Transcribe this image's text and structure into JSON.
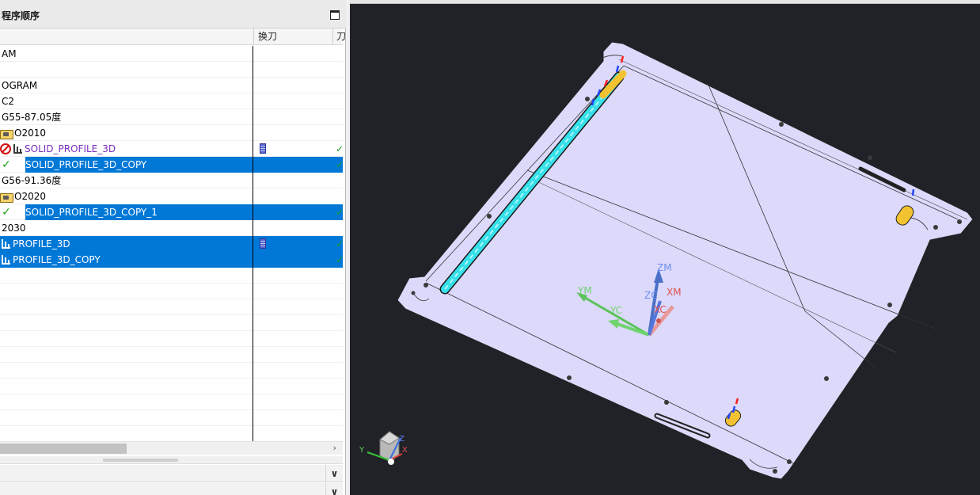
{
  "navigator": {
    "title": "程序顺序",
    "columns": {
      "change_tool": "换刀",
      "next": "刀"
    },
    "rows": [
      {
        "label": "AM",
        "indent": 0,
        "icon": "",
        "selected": false,
        "status": "",
        "tool": false,
        "check": false
      },
      {
        "label": "",
        "indent": 0,
        "icon": "",
        "selected": false,
        "status": "",
        "tool": false,
        "check": false
      },
      {
        "label": "OGRAM",
        "indent": 0,
        "icon": "",
        "selected": false,
        "status": "",
        "tool": false,
        "check": false
      },
      {
        "label": "C2",
        "indent": 0,
        "icon": "",
        "selected": false,
        "status": "",
        "tool": false,
        "check": false
      },
      {
        "label": "G55-87.05度",
        "indent": 0,
        "icon": "",
        "selected": false,
        "status": "",
        "tool": false,
        "check": false
      },
      {
        "label": "O2010",
        "indent": 0,
        "icon": "folder",
        "selected": false,
        "status": "",
        "tool": false,
        "check": false
      },
      {
        "label": "SOLID_PROFILE_3D",
        "indent": 0,
        "icon": "op",
        "selected": false,
        "status": "no",
        "tool": true,
        "check": true,
        "purple": true
      },
      {
        "label": "SOLID_PROFILE_3D_COPY",
        "indent": 0,
        "icon": "op",
        "selected": true,
        "status": "check",
        "tool": false,
        "check": true
      },
      {
        "label": "G56-91.36度",
        "indent": 0,
        "icon": "",
        "selected": false,
        "status": "",
        "tool": false,
        "check": false
      },
      {
        "label": "O2020",
        "indent": 0,
        "icon": "folder",
        "selected": false,
        "status": "",
        "tool": false,
        "check": false
      },
      {
        "label": "SOLID_PROFILE_3D_COPY_1",
        "indent": 0,
        "icon": "op",
        "selected": true,
        "status": "check",
        "tool": false,
        "check": true
      },
      {
        "label": "2030",
        "indent": 0,
        "icon": "",
        "selected": false,
        "status": "",
        "tool": false,
        "check": false
      },
      {
        "label": "PROFILE_3D",
        "indent": 0,
        "icon": "op",
        "selected": true,
        "status": "",
        "tool": true,
        "check": true
      },
      {
        "label": "PROFILE_3D_COPY",
        "indent": 0,
        "icon": "op",
        "selected": true,
        "status": "",
        "tool": false,
        "check": true
      }
    ],
    "check_mark": "✓",
    "scroll_arrow": "›",
    "panel_chevron": "∨"
  },
  "viewport": {
    "wcs_labels": {
      "zm": "ZM",
      "ym": "YM",
      "yc": "YC",
      "zc": "ZC",
      "xm": "XM",
      "xc": "XC"
    },
    "triad_labels": {
      "x": "X",
      "y": "Y",
      "z": "Z"
    },
    "background": "#212227",
    "part_color": "#dcd9fb"
  }
}
